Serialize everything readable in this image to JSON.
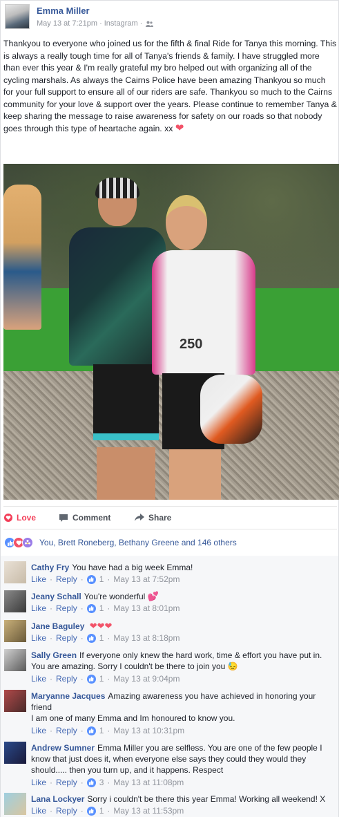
{
  "post": {
    "author": "Emma Miller",
    "timestamp": "May 13 at 7:21pm",
    "source": "Instagram",
    "audience_icon": "friends-icon",
    "text": "Thankyou to everyone who joined us for the fifth & final Ride for Tanya this morning. This is always a really tough time for all of Tanya's friends & family. I have struggled more than ever this year & I'm really grateful my bro helped out with organizing all of the cycling marshals. As always the Cairns Police have been amazing Thankyou so much for your full support to ensure all of our riders are safe. Thankyou so much to the Cairns community for your love & support over the years. Please continue to remember Tanya & keep sharing the message to raise awareness for safety on our roads so that nobody goes through this type of heartache again. xx",
    "text_emoji": "❤",
    "photo_bib_number": "250"
  },
  "actions": {
    "love": "Love",
    "comment": "Comment",
    "share": "Share"
  },
  "reactions": {
    "summary": "You, Brett Roneberg, Bethany Greene and 146 others",
    "colors": {
      "like": "#5890ff",
      "love": "#f25268",
      "other": "#9b7de8"
    }
  },
  "comment_actions": {
    "like": "Like",
    "reply": "Reply"
  },
  "comments": [
    {
      "name": "Cathy Fry",
      "text": "You have had a big week Emma!",
      "emoji": "",
      "likes": "1",
      "time": "May 13 at 7:52pm"
    },
    {
      "name": "Jeany Schall",
      "text": "You're wonderful",
      "emoji": "💕",
      "likes": "1",
      "time": "May 13 at 8:01pm"
    },
    {
      "name": "Jane Baguley",
      "text": "",
      "emoji": "❤❤❤",
      "likes": "1",
      "time": "May 13 at 8:18pm"
    },
    {
      "name": "Sally Green",
      "text": "If everyone only knew the hard work, time & effort you have put in. You are amazing. Sorry I couldn't be there to join you",
      "emoji": "😓",
      "likes": "1",
      "time": "May 13 at 9:04pm"
    },
    {
      "name": "Maryanne Jacques",
      "text": "Amazing awareness you have achieved in honoring your friend",
      "text2": "I am one of many Emma and Im honoured to know you.",
      "emoji": "",
      "likes": "1",
      "time": "May 13 at 10:31pm"
    },
    {
      "name": "Andrew Sumner",
      "text": "Emma Miller you are selfless. You are one of the few people I know that just does it, when everyone else says they could they would they should..... then you turn up, and it happens. Respect",
      "emoji": "",
      "likes": "3",
      "time": "May 13 at 11:08pm"
    },
    {
      "name": "Lana Lockyer",
      "text": "Sorry i couldn't be there this year Emma! Working all weekend! X",
      "emoji": "",
      "likes": "1",
      "time": "May 13 at 11:53pm"
    }
  ],
  "colors": {
    "link_blue": "#365899",
    "action_blue": "#4267b2",
    "meta_gray": "#90949c",
    "love_red": "#f33e58"
  }
}
